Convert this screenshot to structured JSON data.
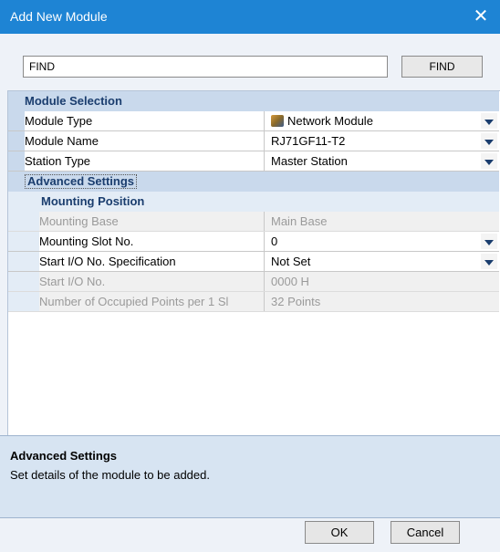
{
  "window": {
    "title": "Add New Module",
    "close_glyph": "✕"
  },
  "find": {
    "input_value": "FIND",
    "button_label": "FIND"
  },
  "grid": {
    "module_selection": {
      "header": "Module Selection",
      "rows": [
        {
          "label": "Module Type",
          "value": "Network Module",
          "icon": "network-module-icon"
        },
        {
          "label": "Module Name",
          "value": "RJ71GF11-T2"
        },
        {
          "label": "Station Type",
          "value": "Master Station"
        }
      ]
    },
    "advanced_settings": {
      "header": "Advanced Settings",
      "mounting_position": {
        "header": "Mounting Position",
        "rows": [
          {
            "label": "Mounting Base",
            "value": "Main Base",
            "enabled": false
          },
          {
            "label": "Mounting Slot No.",
            "value": "0",
            "enabled": true
          },
          {
            "label": "Start I/O No. Specification",
            "value": "Not Set",
            "enabled": true
          },
          {
            "label": "Start I/O No.",
            "value": "0000 H",
            "enabled": false
          },
          {
            "label": "Number of Occupied Points per 1 Sl",
            "value": "32 Points",
            "enabled": false
          }
        ]
      }
    }
  },
  "description": {
    "title": "Advanced Settings",
    "text": "Set details of the module to be added."
  },
  "buttons": {
    "ok": "OK",
    "cancel": "Cancel"
  },
  "colors": {
    "titlebar": "#1e84d4",
    "category_bg": "#c9d9ec",
    "category_text": "#1a3d6e"
  }
}
